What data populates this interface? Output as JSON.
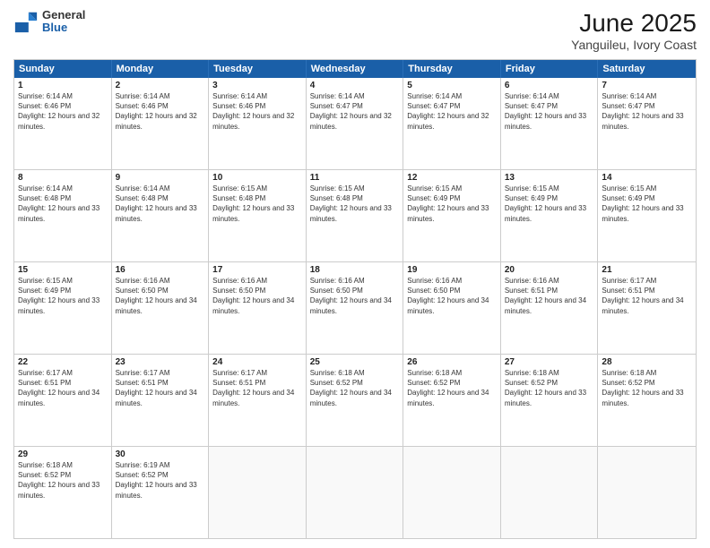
{
  "logo": {
    "line1": "General",
    "line2": "Blue"
  },
  "title": "June 2025",
  "subtitle": "Yanguileu, Ivory Coast",
  "header": {
    "days": [
      "Sunday",
      "Monday",
      "Tuesday",
      "Wednesday",
      "Thursday",
      "Friday",
      "Saturday"
    ]
  },
  "rows": [
    [
      {
        "day": "1",
        "rise": "6:14 AM",
        "set": "6:46 PM",
        "daylight": "12 hours and 32 minutes."
      },
      {
        "day": "2",
        "rise": "6:14 AM",
        "set": "6:46 PM",
        "daylight": "12 hours and 32 minutes."
      },
      {
        "day": "3",
        "rise": "6:14 AM",
        "set": "6:46 PM",
        "daylight": "12 hours and 32 minutes."
      },
      {
        "day": "4",
        "rise": "6:14 AM",
        "set": "6:47 PM",
        "daylight": "12 hours and 32 minutes."
      },
      {
        "day": "5",
        "rise": "6:14 AM",
        "set": "6:47 PM",
        "daylight": "12 hours and 32 minutes."
      },
      {
        "day": "6",
        "rise": "6:14 AM",
        "set": "6:47 PM",
        "daylight": "12 hours and 33 minutes."
      },
      {
        "day": "7",
        "rise": "6:14 AM",
        "set": "6:47 PM",
        "daylight": "12 hours and 33 minutes."
      }
    ],
    [
      {
        "day": "8",
        "rise": "6:14 AM",
        "set": "6:48 PM",
        "daylight": "12 hours and 33 minutes."
      },
      {
        "day": "9",
        "rise": "6:14 AM",
        "set": "6:48 PM",
        "daylight": "12 hours and 33 minutes."
      },
      {
        "day": "10",
        "rise": "6:15 AM",
        "set": "6:48 PM",
        "daylight": "12 hours and 33 minutes."
      },
      {
        "day": "11",
        "rise": "6:15 AM",
        "set": "6:48 PM",
        "daylight": "12 hours and 33 minutes."
      },
      {
        "day": "12",
        "rise": "6:15 AM",
        "set": "6:49 PM",
        "daylight": "12 hours and 33 minutes."
      },
      {
        "day": "13",
        "rise": "6:15 AM",
        "set": "6:49 PM",
        "daylight": "12 hours and 33 minutes."
      },
      {
        "day": "14",
        "rise": "6:15 AM",
        "set": "6:49 PM",
        "daylight": "12 hours and 33 minutes."
      }
    ],
    [
      {
        "day": "15",
        "rise": "6:15 AM",
        "set": "6:49 PM",
        "daylight": "12 hours and 33 minutes."
      },
      {
        "day": "16",
        "rise": "6:16 AM",
        "set": "6:50 PM",
        "daylight": "12 hours and 34 minutes."
      },
      {
        "day": "17",
        "rise": "6:16 AM",
        "set": "6:50 PM",
        "daylight": "12 hours and 34 minutes."
      },
      {
        "day": "18",
        "rise": "6:16 AM",
        "set": "6:50 PM",
        "daylight": "12 hours and 34 minutes."
      },
      {
        "day": "19",
        "rise": "6:16 AM",
        "set": "6:50 PM",
        "daylight": "12 hours and 34 minutes."
      },
      {
        "day": "20",
        "rise": "6:16 AM",
        "set": "6:51 PM",
        "daylight": "12 hours and 34 minutes."
      },
      {
        "day": "21",
        "rise": "6:17 AM",
        "set": "6:51 PM",
        "daylight": "12 hours and 34 minutes."
      }
    ],
    [
      {
        "day": "22",
        "rise": "6:17 AM",
        "set": "6:51 PM",
        "daylight": "12 hours and 34 minutes."
      },
      {
        "day": "23",
        "rise": "6:17 AM",
        "set": "6:51 PM",
        "daylight": "12 hours and 34 minutes."
      },
      {
        "day": "24",
        "rise": "6:17 AM",
        "set": "6:51 PM",
        "daylight": "12 hours and 34 minutes."
      },
      {
        "day": "25",
        "rise": "6:18 AM",
        "set": "6:52 PM",
        "daylight": "12 hours and 34 minutes."
      },
      {
        "day": "26",
        "rise": "6:18 AM",
        "set": "6:52 PM",
        "daylight": "12 hours and 34 minutes."
      },
      {
        "day": "27",
        "rise": "6:18 AM",
        "set": "6:52 PM",
        "daylight": "12 hours and 33 minutes."
      },
      {
        "day": "28",
        "rise": "6:18 AM",
        "set": "6:52 PM",
        "daylight": "12 hours and 33 minutes."
      }
    ],
    [
      {
        "day": "29",
        "rise": "6:18 AM",
        "set": "6:52 PM",
        "daylight": "12 hours and 33 minutes."
      },
      {
        "day": "30",
        "rise": "6:19 AM",
        "set": "6:52 PM",
        "daylight": "12 hours and 33 minutes."
      },
      null,
      null,
      null,
      null,
      null
    ]
  ],
  "labels": {
    "sunrise": "Sunrise:",
    "sunset": "Sunset:",
    "daylight": "Daylight:"
  }
}
